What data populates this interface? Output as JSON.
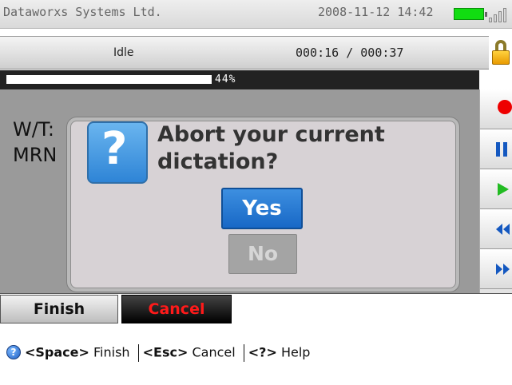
{
  "status_bar": {
    "company": "Dataworxs Systems Ltd.",
    "datetime": "2008-11-12  14:42"
  },
  "dictation": {
    "state": "Idle",
    "timer": "000:16 / 000:37"
  },
  "progress": {
    "percent": 44,
    "label": "44%"
  },
  "background_content": {
    "wt_label": "W/T:",
    "mrn_label": "MRN"
  },
  "controls": [
    {
      "name": "record",
      "icon": "record-icon"
    },
    {
      "name": "pause",
      "icon": "pause-icon"
    },
    {
      "name": "play",
      "icon": "play-icon"
    },
    {
      "name": "rewind",
      "icon": "rewind-icon"
    },
    {
      "name": "fast-forward",
      "icon": "fast-forward-icon"
    }
  ],
  "dialog": {
    "message": "Abort your current dictation?",
    "yes_label": "Yes",
    "no_label": "No"
  },
  "actions": {
    "finish_label": "Finish",
    "cancel_label": "Cancel"
  },
  "hint": {
    "space_key": "<Space>",
    "space_action": " Finish ",
    "esc_key": "<Esc>",
    "esc_action": " Cancel ",
    "help_key": "<?>",
    "help_action": " Help"
  },
  "colors": {
    "accent_blue": "#1868c6",
    "record_red": "#ee0000",
    "play_green": "#22bb22",
    "battery_green": "#11dd11",
    "cancel_red": "#ff1a1a"
  }
}
